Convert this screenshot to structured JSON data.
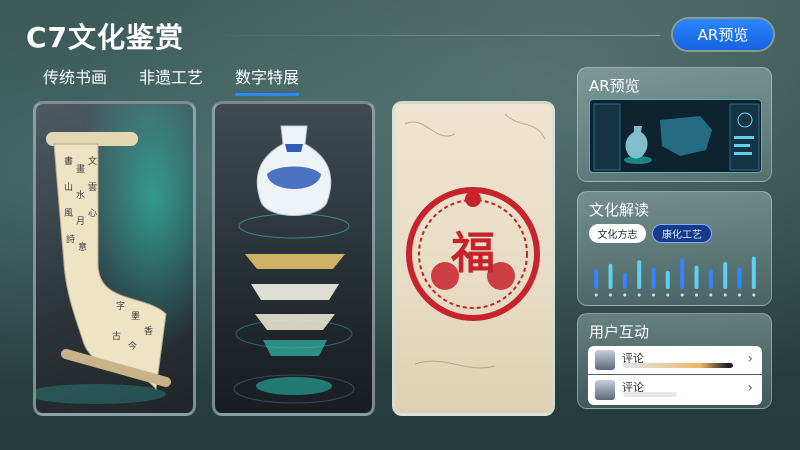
{
  "header": {
    "title": "C7文化鉴赏",
    "ar_button_label": "AR预览"
  },
  "tabs": [
    {
      "label": "传统书画",
      "active": false
    },
    {
      "label": "非遗工艺",
      "active": false
    },
    {
      "label": "数字特展",
      "active": true
    }
  ],
  "cards": [
    {
      "subject": "calligraphy scroll"
    },
    {
      "subject": "blue-and-white porcelain vase with paper-cut layers"
    },
    {
      "subject": "paper-cut fu character",
      "glyph": "福"
    }
  ],
  "panels": {
    "ar_preview": {
      "title": "AR预览"
    },
    "culture": {
      "title": "文化解读",
      "pills": [
        "文化方志",
        "康化工艺"
      ],
      "bars": [
        0.55,
        0.7,
        0.45,
        0.8,
        0.6,
        0.5,
        0.85,
        0.65,
        0.55,
        0.75,
        0.6,
        0.9
      ]
    },
    "interaction": {
      "title": "用户互动",
      "comments": [
        {
          "label": "评论"
        },
        {
          "label": "评论"
        }
      ]
    }
  },
  "colors": {
    "accent": "#1f6fff",
    "active_pill": "#173b8a"
  }
}
